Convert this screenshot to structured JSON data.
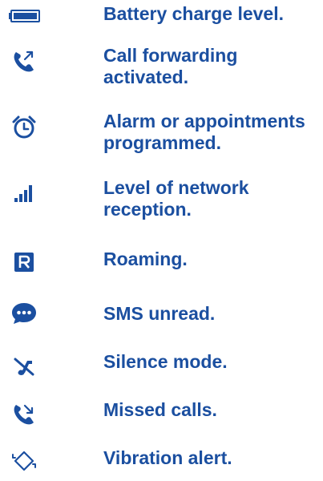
{
  "icon_color": "#1b4fa0",
  "items": [
    {
      "icon": "battery-icon",
      "label": "Battery charge level."
    },
    {
      "icon": "call-forwarding-icon",
      "label": "Call forwarding\nactivated."
    },
    {
      "icon": "alarm-clock-icon",
      "label": "Alarm or appointments\nprogrammed."
    },
    {
      "icon": "signal-bars-icon",
      "label": "Level of network\nreception."
    },
    {
      "icon": "roaming-icon",
      "label": "Roaming."
    },
    {
      "icon": "sms-unread-icon",
      "label": "SMS unread."
    },
    {
      "icon": "silence-mode-icon",
      "label": "Silence mode."
    },
    {
      "icon": "missed-calls-icon",
      "label": "Missed calls."
    },
    {
      "icon": "vibration-icon",
      "label": "Vibration alert."
    }
  ]
}
